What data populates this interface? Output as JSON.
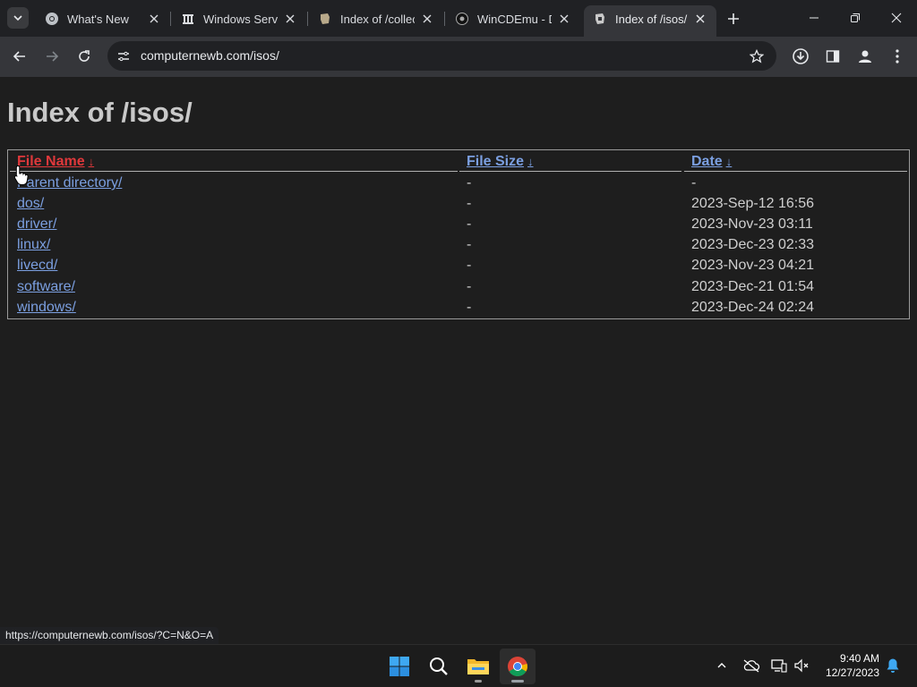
{
  "browser": {
    "tabs": [
      {
        "title": "What's New",
        "icon": "chrome-icon",
        "active": false
      },
      {
        "title": "Windows Serve",
        "icon": "archive-icon",
        "active": false
      },
      {
        "title": "Index of /collec",
        "icon": "folder-icon",
        "active": false
      },
      {
        "title": "WinCDEmu - D",
        "icon": "gear-icon",
        "active": false
      },
      {
        "title": "Index of /isos/",
        "icon": "folder-icon",
        "active": true
      }
    ],
    "url": "computernewb.com/isos/"
  },
  "page": {
    "heading": "Index of /isos/",
    "columns": {
      "name": "File Name",
      "size": "File Size",
      "date": "Date",
      "sort_arrow": "↓"
    },
    "rows": [
      {
        "name": "Parent directory/",
        "size": "-",
        "date": "-"
      },
      {
        "name": "dos/",
        "size": "-",
        "date": "2023-Sep-12 16:56"
      },
      {
        "name": "driver/",
        "size": "-",
        "date": "2023-Nov-23 03:11"
      },
      {
        "name": "linux/",
        "size": "-",
        "date": "2023-Dec-23 02:33"
      },
      {
        "name": "livecd/",
        "size": "-",
        "date": "2023-Nov-23 04:21"
      },
      {
        "name": "software/",
        "size": "-",
        "date": "2023-Dec-21 01:54"
      },
      {
        "name": "windows/",
        "size": "-",
        "date": "2023-Dec-24 02:24"
      }
    ]
  },
  "status_bar": "https://computernewb.com/isos/?C=N&O=A",
  "taskbar": {
    "time": "9:40 AM",
    "date": "12/27/2023"
  },
  "colors": {
    "link": "#7b9fe0",
    "active_header": "#e0383b"
  }
}
